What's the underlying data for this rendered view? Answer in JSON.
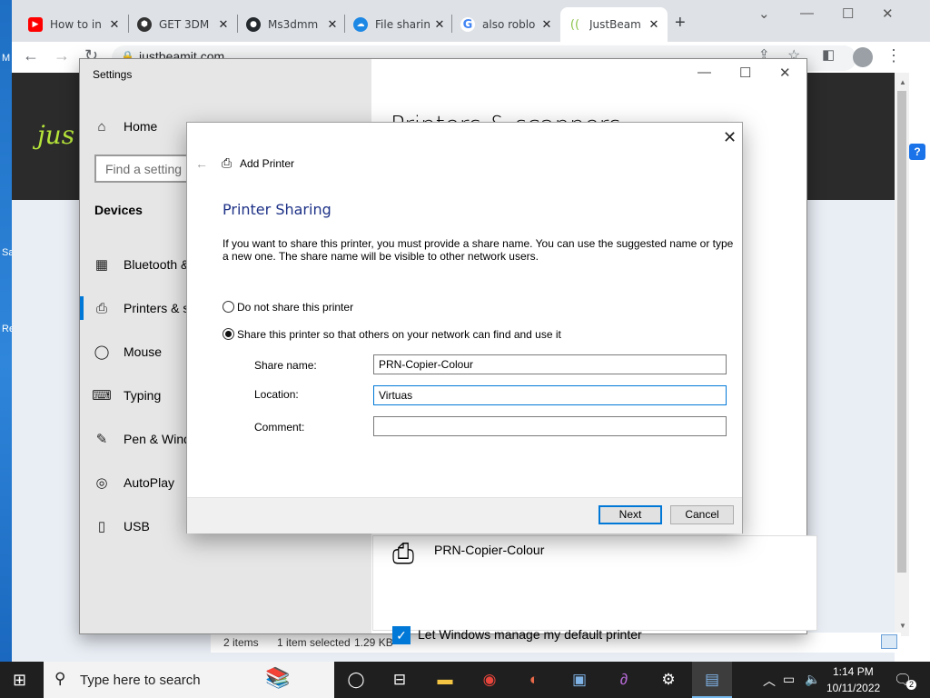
{
  "desktop": {
    "edge_labels": [
      "M",
      "Sa",
      "Re"
    ]
  },
  "browser": {
    "tabs": [
      {
        "title": "How to in",
        "favicon": "youtube-icon",
        "color": "#ff0000"
      },
      {
        "title": "GET 3DM",
        "favicon": "hexagon-icon",
        "color": "#333333"
      },
      {
        "title": "Ms3dmm",
        "favicon": "github-icon",
        "color": "#24292e"
      },
      {
        "title": "File sharin",
        "favicon": "cloud-icon",
        "color": "#1e88e5"
      },
      {
        "title": "also roblo",
        "favicon": "google-icon",
        "color": "#4285f4"
      },
      {
        "title": "JustBeam",
        "favicon": "justbeam-icon",
        "color": "#8bc34a"
      }
    ],
    "url": "justbeamit.com",
    "page_logo": "jus",
    "help": "?"
  },
  "explorer_status": {
    "items": "2 items",
    "selected": "1 item selected",
    "size": "1.29 KB"
  },
  "settings": {
    "window_title": "Settings",
    "home": "Home",
    "search_placeholder": "Find a setting",
    "section": "Devices",
    "nav": [
      {
        "label": "Bluetooth &",
        "icon": "bluetooth-icon"
      },
      {
        "label": "Printers & s",
        "icon": "printer-icon"
      },
      {
        "label": "Mouse",
        "icon": "mouse-icon"
      },
      {
        "label": "Typing",
        "icon": "keyboard-icon"
      },
      {
        "label": "Pen & Wind",
        "icon": "pen-icon"
      },
      {
        "label": "AutoPlay",
        "icon": "autoplay-icon"
      },
      {
        "label": "USB",
        "icon": "usb-icon"
      }
    ],
    "selected_nav": "Printers & s",
    "page_title": "Printers & scanners",
    "printer_name": "PRN-Copier-Colour",
    "checkbox_label": "Let Windows manage my default printer"
  },
  "dialog": {
    "title": "Add Printer",
    "heading": "Printer Sharing",
    "description": "If you want to share this printer, you must provide a share name. You can use the suggested name or type a new one. The share name will be visible to other network users.",
    "option_no_share": "Do not share this printer",
    "option_share": "Share this printer so that others on your network can find and use it",
    "selected_option": "share",
    "share_name_label": "Share name:",
    "share_name_value": "PRN-Copier-Colour",
    "location_label": "Location:",
    "location_value": "Virtuas",
    "comment_label": "Comment:",
    "comment_value": "",
    "next_label": "Next",
    "cancel_label": "Cancel"
  },
  "taskbar": {
    "search_placeholder": "Type here to search",
    "time": "1:14 PM",
    "date": "10/11/2022",
    "notification_count": "2"
  }
}
